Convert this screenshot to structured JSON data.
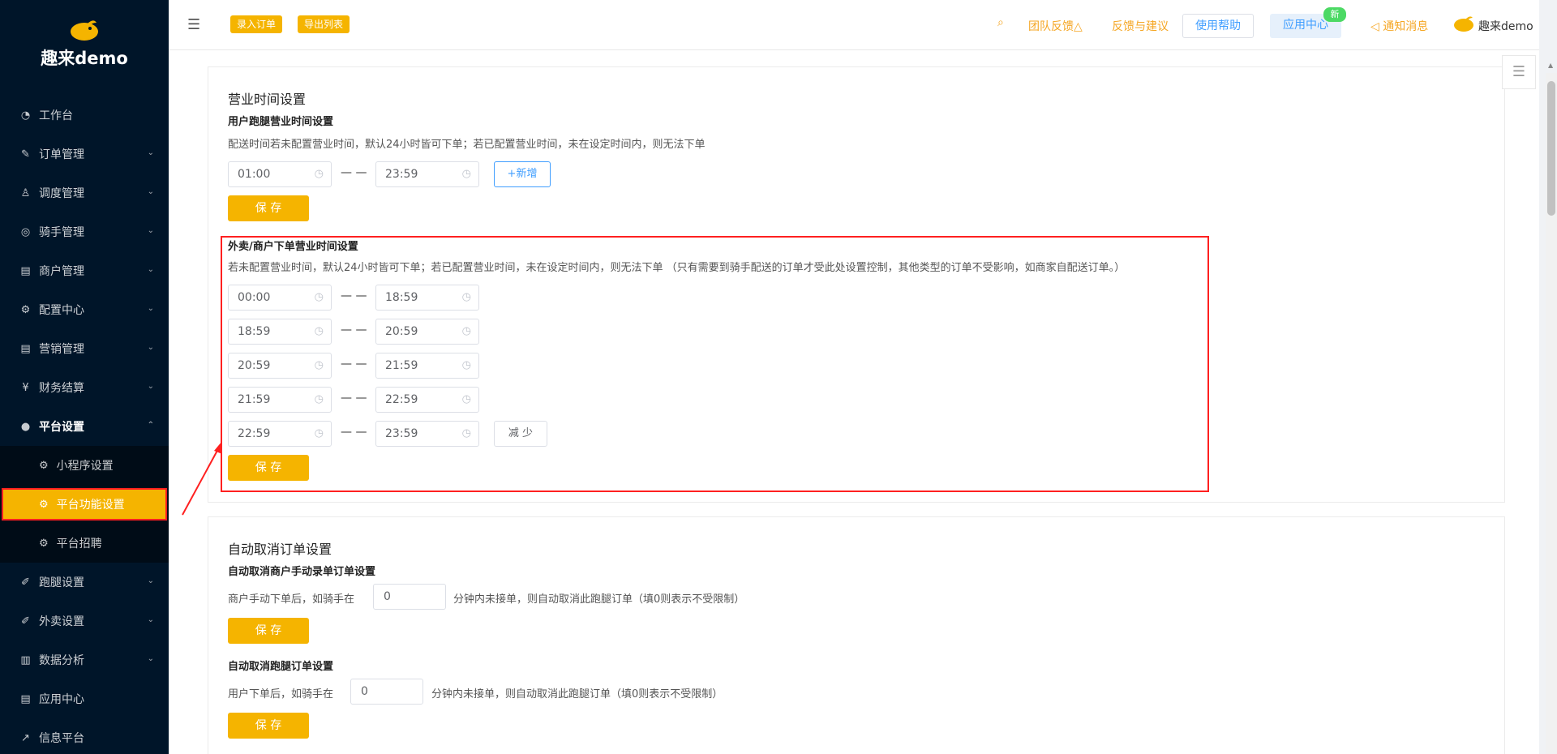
{
  "brand": {
    "name": "趣来demo"
  },
  "sidebar": {
    "items": [
      {
        "label": "工作台",
        "icon": "dashboard-icon"
      },
      {
        "label": "订单管理",
        "icon": "edit-icon"
      },
      {
        "label": "调度管理",
        "icon": "user-icon"
      },
      {
        "label": "骑手管理",
        "icon": "check-circle-icon"
      },
      {
        "label": "商户管理",
        "icon": "shop-icon"
      },
      {
        "label": "配置中心",
        "icon": "gear-icon"
      },
      {
        "label": "营销管理",
        "icon": "shop-icon"
      },
      {
        "label": "财务结算",
        "icon": "money-icon"
      },
      {
        "label": "平台设置",
        "icon": "wechat-icon"
      }
    ],
    "sub_items": [
      {
        "label": "小程序设置"
      },
      {
        "label": "平台功能设置"
      },
      {
        "label": "平台招聘"
      }
    ],
    "items_after": [
      {
        "label": "跑腿设置"
      },
      {
        "label": "外卖设置"
      },
      {
        "label": "数据分析"
      },
      {
        "label": "应用中心"
      },
      {
        "label": "信息平台"
      }
    ]
  },
  "header": {
    "btn_entry": "录入订单",
    "btn_export": "导出列表",
    "team_feedback": "团队反馈",
    "feedback": "反馈与建议",
    "help": "使用帮助",
    "app_center": "应用中心",
    "badge_new": "新",
    "notifications": "通知消息",
    "user": "趣来demo"
  },
  "business_hours": {
    "title": "营业时间设置",
    "runner": {
      "subtitle": "用户跑腿营业时间设置",
      "desc": "配送时间若未配置营业时间，默认24小时皆可下单；若已配置营业时间，未在设定时间内，则无法下单",
      "start": "01:00",
      "end": "23:59",
      "add_label": "+新增",
      "save_label": "保 存"
    },
    "merchant": {
      "subtitle": "外卖/商户下单营业时间设置",
      "desc": "若未配置营业时间，默认24小时皆可下单；若已配置营业时间，未在设定时间内，则无法下单 （只有需要到骑手配送的订单才受此处设置控制，其他类型的订单不受影响，如商家自配送订单。）",
      "ranges": [
        {
          "start": "00:00",
          "end": "18:59"
        },
        {
          "start": "18:59",
          "end": "20:59"
        },
        {
          "start": "20:59",
          "end": "21:59"
        },
        {
          "start": "21:59",
          "end": "22:59"
        },
        {
          "start": "22:59",
          "end": "23:59"
        }
      ],
      "reduce_label": "减 少",
      "save_label": "保 存"
    },
    "dash": "— —"
  },
  "auto_cancel": {
    "title": "自动取消订单设置",
    "merchant": {
      "subtitle": "自动取消商户手动录单订单设置",
      "prefix": "商户手动下单后，如骑手在",
      "value": "0",
      "suffix": "分钟内未接单，则自动取消此跑腿订单（填0则表示不受限制）",
      "save_label": "保 存"
    },
    "runner": {
      "subtitle": "自动取消跑腿订单设置",
      "prefix": "用户下单后，如骑手在",
      "value": "0",
      "suffix": "分钟内未接单，则自动取消此跑腿订单（填0则表示不受限制）",
      "save_label": "保 存"
    }
  },
  "colors": {
    "accent": "#f5b400",
    "sidebar": "#001529",
    "highlight": "#ff2020"
  }
}
